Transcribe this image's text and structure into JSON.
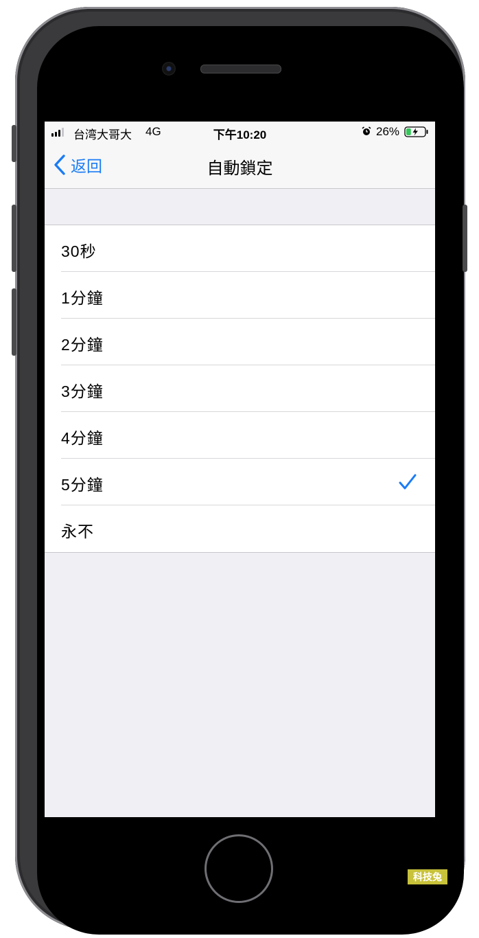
{
  "status_bar": {
    "carrier": "台湾大哥大",
    "network": "4G",
    "time": "下午10:20",
    "battery_percent": "26%",
    "signal_bars_active": 3,
    "battery_level": 0.26,
    "alarm_icon": "alarm-clock-icon"
  },
  "nav": {
    "back_label": "返回",
    "title": "自動鎖定"
  },
  "options": [
    {
      "label": "30秒",
      "selected": false
    },
    {
      "label": "1分鐘",
      "selected": false
    },
    {
      "label": "2分鐘",
      "selected": false
    },
    {
      "label": "3分鐘",
      "selected": false
    },
    {
      "label": "4分鐘",
      "selected": false
    },
    {
      "label": "5分鐘",
      "selected": true
    },
    {
      "label": "永不",
      "selected": false
    }
  ],
  "colors": {
    "accent": "#1a7cf5",
    "battery_charging": "#34c759",
    "watermark_bg": "#c8c23a"
  },
  "watermark": "科技兔"
}
